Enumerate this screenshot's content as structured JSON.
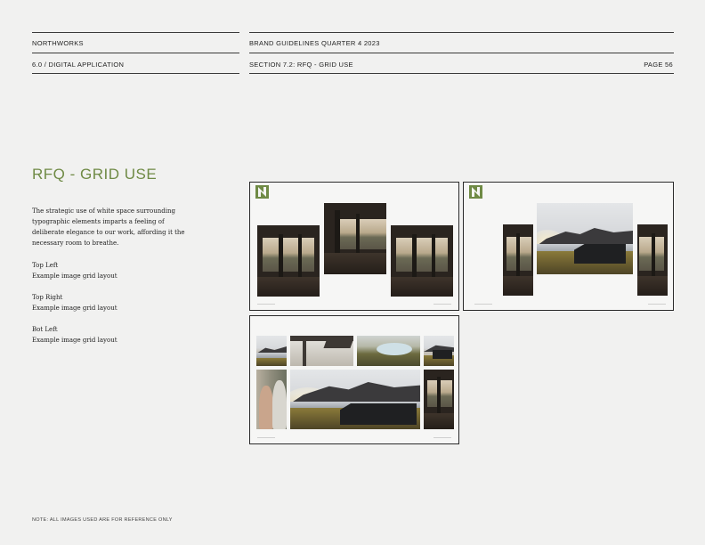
{
  "header": {
    "brand": "NORTHWORKS",
    "doc_title": "BRAND GUIDELINES QUARTER 4 2023",
    "section_left": "6.0 / DIGITAL APPLICATION",
    "section_right": "SECTION 7.2: RFQ - GRID USE",
    "page": "PAGE 56"
  },
  "title": "RFQ - GRID USE",
  "intro": "The strategic use of white space surrounding typographic elements imparts a feeling of deliberate elegance to our work, affording it the necessary room to breathe.",
  "captions": [
    {
      "label": "Top Left",
      "desc": "Example image grid layout"
    },
    {
      "label": "Top Right",
      "desc": "Example image grid layout"
    },
    {
      "label": "Bot Left",
      "desc": "Example image grid layout"
    }
  ],
  "note": "NOTE: ALL IMAGES USED ARE FOR REFERENCE ONLY",
  "colors": {
    "accent": "#6f8a45",
    "rule": "#3a3a3a"
  },
  "icons": {
    "logo": "n-monogram-icon"
  }
}
